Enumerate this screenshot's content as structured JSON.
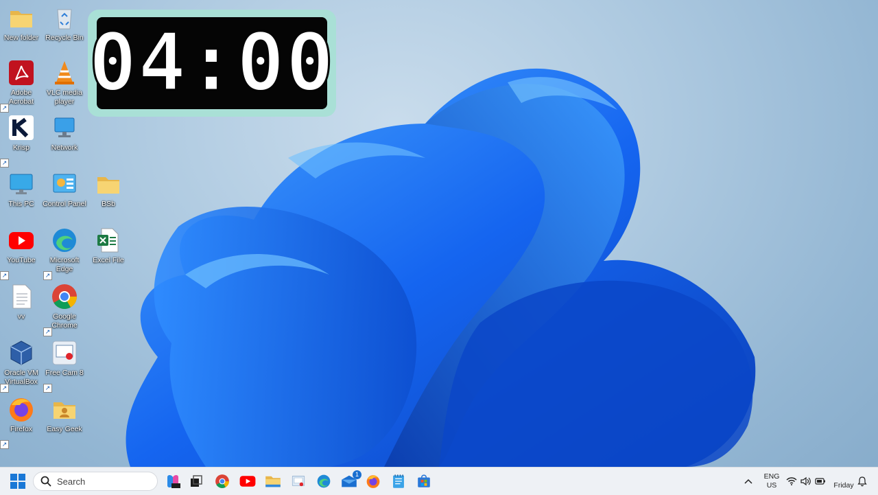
{
  "clock": {
    "time": "04:00"
  },
  "desktop_icons": [
    {
      "label": "New folder"
    },
    {
      "label": "Recycle Bin"
    },
    {
      "label": "Adobe Acrobat"
    },
    {
      "label": "VLC media player"
    },
    {
      "label": "Krisp"
    },
    {
      "label": "Network"
    },
    {
      "label": "This PC"
    },
    {
      "label": "Control Panel"
    },
    {
      "label": "BSb"
    },
    {
      "label": "YouTube"
    },
    {
      "label": "Microsoft Edge"
    },
    {
      "label": "Excel File"
    },
    {
      "label": "vv"
    },
    {
      "label": "Google Chrome"
    },
    {
      "label": "Oracle VM VirtualBox"
    },
    {
      "label": "Free Cam 8"
    },
    {
      "label": "Firefox"
    },
    {
      "label": "Easy Geek"
    }
  ],
  "taskbar": {
    "search_placeholder": "Search",
    "apps": [
      "windows-start",
      "copilot",
      "task-view",
      "chrome",
      "youtube",
      "file-explorer",
      "control-panel",
      "edge",
      "mail",
      "firefox",
      "notepad",
      "store"
    ],
    "mail_badge": "1",
    "language_line1": "ENG",
    "language_line2": "US",
    "day": "Friday"
  },
  "colors": {
    "accent": "#1a6fe0",
    "widget_border": "#a9e0d6",
    "widget_face": "#050505"
  }
}
